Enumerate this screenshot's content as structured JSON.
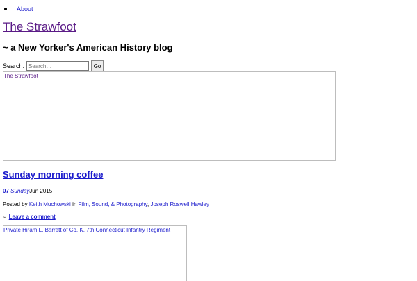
{
  "nav": {
    "items": [
      {
        "label": "About"
      }
    ]
  },
  "site": {
    "title": "The Strawfoot",
    "tagline": "~ a New Yorker's American History blog"
  },
  "search": {
    "label": "Search:",
    "placeholder": "Search…",
    "button_label": "Go"
  },
  "header_image": {
    "alt": "The Strawfoot"
  },
  "post": {
    "title": "Sunday morning coffee",
    "date": {
      "day": "07",
      "weekday": "Sunday",
      "month_year": "Jun 2015"
    },
    "meta": {
      "posted_by_prefix": "Posted by",
      "author": "Keith Muchowski",
      "in_word": "in",
      "categories": [
        "Film, Sound, & Photography",
        "Joseph Roswell Hawley"
      ],
      "separator": ","
    },
    "comments": {
      "icon": "≈",
      "label": "Leave a comment"
    },
    "image": {
      "alt": "Private Hiram L. Barrett of Co. K. 7th Connecticut Infantry Regiment"
    }
  },
  "colors": {
    "link": "#1b1bcc",
    "visited_link": "#5a1a86"
  }
}
